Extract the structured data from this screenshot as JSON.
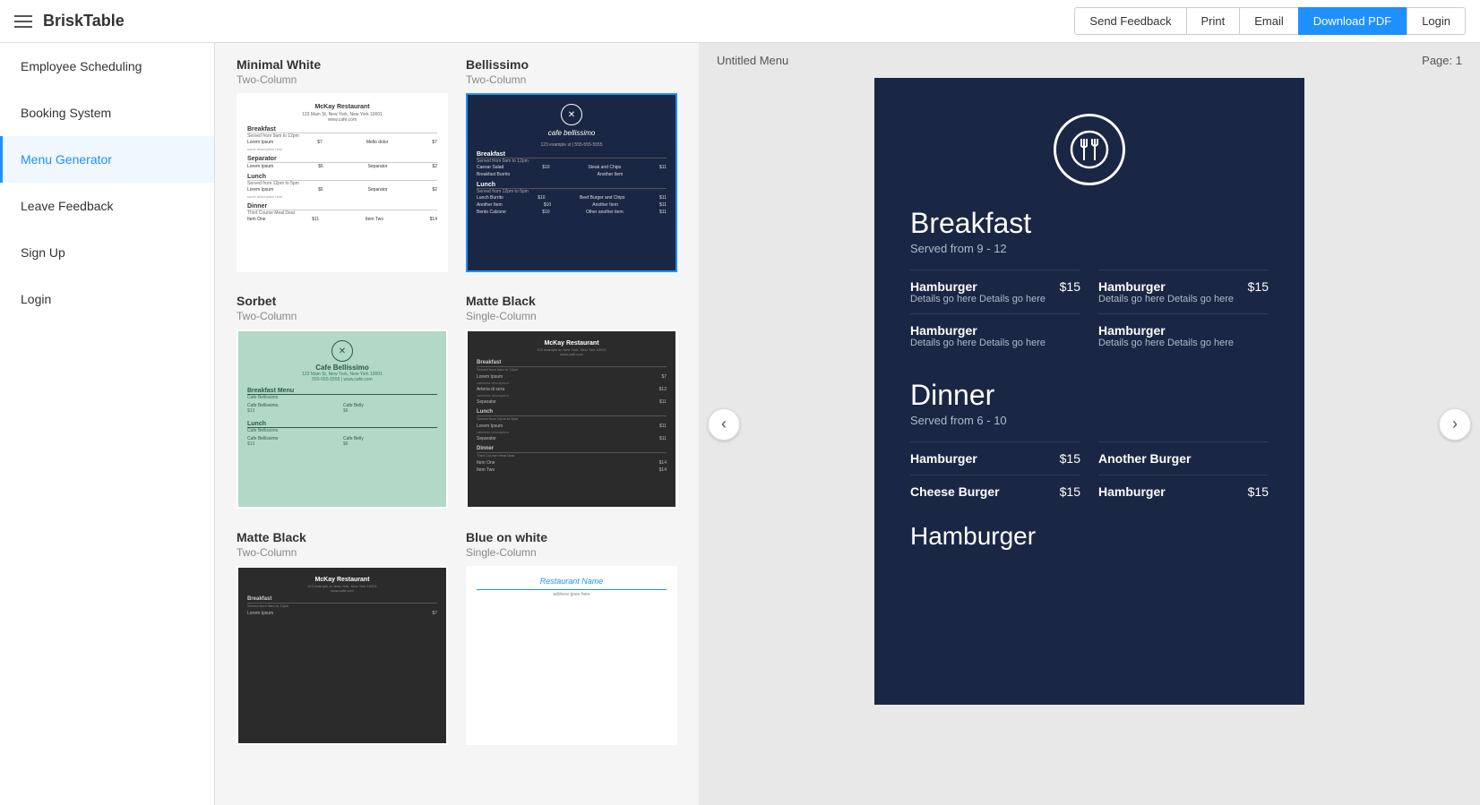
{
  "header": {
    "brand": "BriskTable",
    "brand_bold": "Brisk",
    "brand_normal": "Table",
    "buttons": {
      "send_feedback": "Send Feedback",
      "print": "Print",
      "email": "Email",
      "download_pdf": "Download PDF",
      "login": "Login"
    }
  },
  "sidebar": {
    "items": [
      {
        "id": "employee-scheduling",
        "label": "Employee Scheduling",
        "active": false
      },
      {
        "id": "booking-system",
        "label": "Booking System",
        "active": false
      },
      {
        "id": "menu-generator",
        "label": "Menu Generator",
        "active": true
      },
      {
        "id": "leave-feedback",
        "label": "Leave Feedback",
        "active": false
      },
      {
        "id": "sign-up",
        "label": "Sign Up",
        "active": false
      },
      {
        "id": "login",
        "label": "Login",
        "active": false
      }
    ]
  },
  "templates": [
    {
      "row": 0,
      "left": {
        "name": "Minimal White",
        "column": "Two-Column",
        "selected": false,
        "style": "minimal"
      },
      "right": {
        "name": "Bellissimo",
        "column": "Two-Column",
        "selected": true,
        "style": "bellissimo"
      }
    },
    {
      "row": 1,
      "left": {
        "name": "Sorbet",
        "column": "Two-Column",
        "selected": false,
        "style": "sorbet"
      },
      "right": {
        "name": "Matte Black",
        "column": "Single-Column",
        "selected": false,
        "style": "matte"
      }
    },
    {
      "row": 2,
      "left": {
        "name": "Matte Black",
        "column": "Two-Column",
        "selected": false,
        "style": "matte"
      },
      "right": {
        "name": "Blue on white",
        "column": "Single-Column",
        "selected": false,
        "style": "blueonwhite"
      }
    }
  ],
  "preview": {
    "title": "Untitled Menu",
    "page_label": "Page:",
    "page_number": "1",
    "menu": {
      "sections": [
        {
          "name": "Breakfast",
          "subtitle": "Served from 9 - 12",
          "layout": "two-column",
          "items": [
            {
              "name": "Hamburger",
              "desc": "Details go here Details go here",
              "price": "$15"
            },
            {
              "name": "Hamburger",
              "desc": "Details go here Details go here",
              "price": "$15"
            },
            {
              "name": "Hamburger",
              "desc": "Details go here Details go here",
              "price": null
            },
            {
              "name": "Hamburger",
              "desc": "Details go here Details go here",
              "price": null
            }
          ]
        },
        {
          "name": "Dinner",
          "subtitle": "Served from 6 - 10",
          "layout": "single",
          "items": [
            {
              "name": "Hamburger",
              "price": "$15",
              "col": 0
            },
            {
              "name": "Another Burger",
              "price": null,
              "col": 1
            },
            {
              "name": "Cheese Burger",
              "price": "$15",
              "col": 0
            },
            {
              "name": "Hamburger",
              "price": "$15",
              "col": 1
            }
          ]
        },
        {
          "name": "Hamburger",
          "subtitle": null,
          "layout": "big",
          "items": []
        }
      ]
    }
  }
}
